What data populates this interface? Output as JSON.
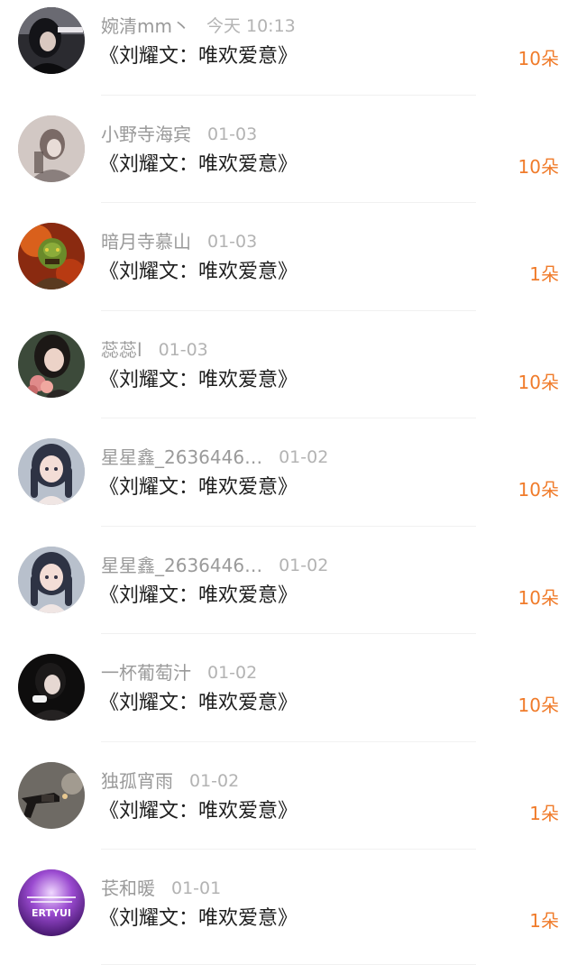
{
  "records": [
    {
      "name": "婉清mm丶",
      "date": "今天 10:13",
      "gift": "《刘耀文：唯欢爱意》",
      "count": "10朵",
      "avatar": "dark-girl-avatar"
    },
    {
      "name": "小野寺海宾",
      "date": "01-03",
      "gift": "《刘耀文：唯欢爱意》",
      "count": "10朵",
      "avatar": "pale-girl-avatar"
    },
    {
      "name": "暗月寺慕山",
      "date": "01-03",
      "gift": "《刘耀文：唯欢爱意》",
      "count": "1朵",
      "avatar": "orc-warrior-avatar"
    },
    {
      "name": "蕊蕊l",
      "date": "01-03",
      "gift": "《刘耀文：唯欢爱意》",
      "count": "10朵",
      "avatar": "girl-with-flowers-avatar"
    },
    {
      "name": "星星鑫_2636446…",
      "date": "01-02",
      "gift": "《刘耀文：唯欢爱意》",
      "count": "10朵",
      "avatar": "anime-girl-avatar"
    },
    {
      "name": "星星鑫_2636446…",
      "date": "01-02",
      "gift": "《刘耀文：唯欢爱意》",
      "count": "10朵",
      "avatar": "anime-girl-avatar"
    },
    {
      "name": "一杯葡萄汁",
      "date": "01-02",
      "gift": "《刘耀文：唯欢爱意》",
      "count": "10朵",
      "avatar": "dark-portrait-avatar"
    },
    {
      "name": "独孤宵雨",
      "date": "01-02",
      "gift": "《刘耀文：唯欢爱意》",
      "count": "1朵",
      "avatar": "revolver-avatar"
    },
    {
      "name": "苌和暖",
      "date": "01-01",
      "gift": "《刘耀文：唯欢爱意》",
      "count": "1朵",
      "avatar": "purple-text-avatar"
    }
  ],
  "avatar_text": "ERTYUI",
  "colors": {
    "count": "#f07b2a",
    "name": "#9a9a9a",
    "date": "#b3b3b3",
    "gift": "#1e1e1e",
    "divider": "#f1f1f1"
  }
}
